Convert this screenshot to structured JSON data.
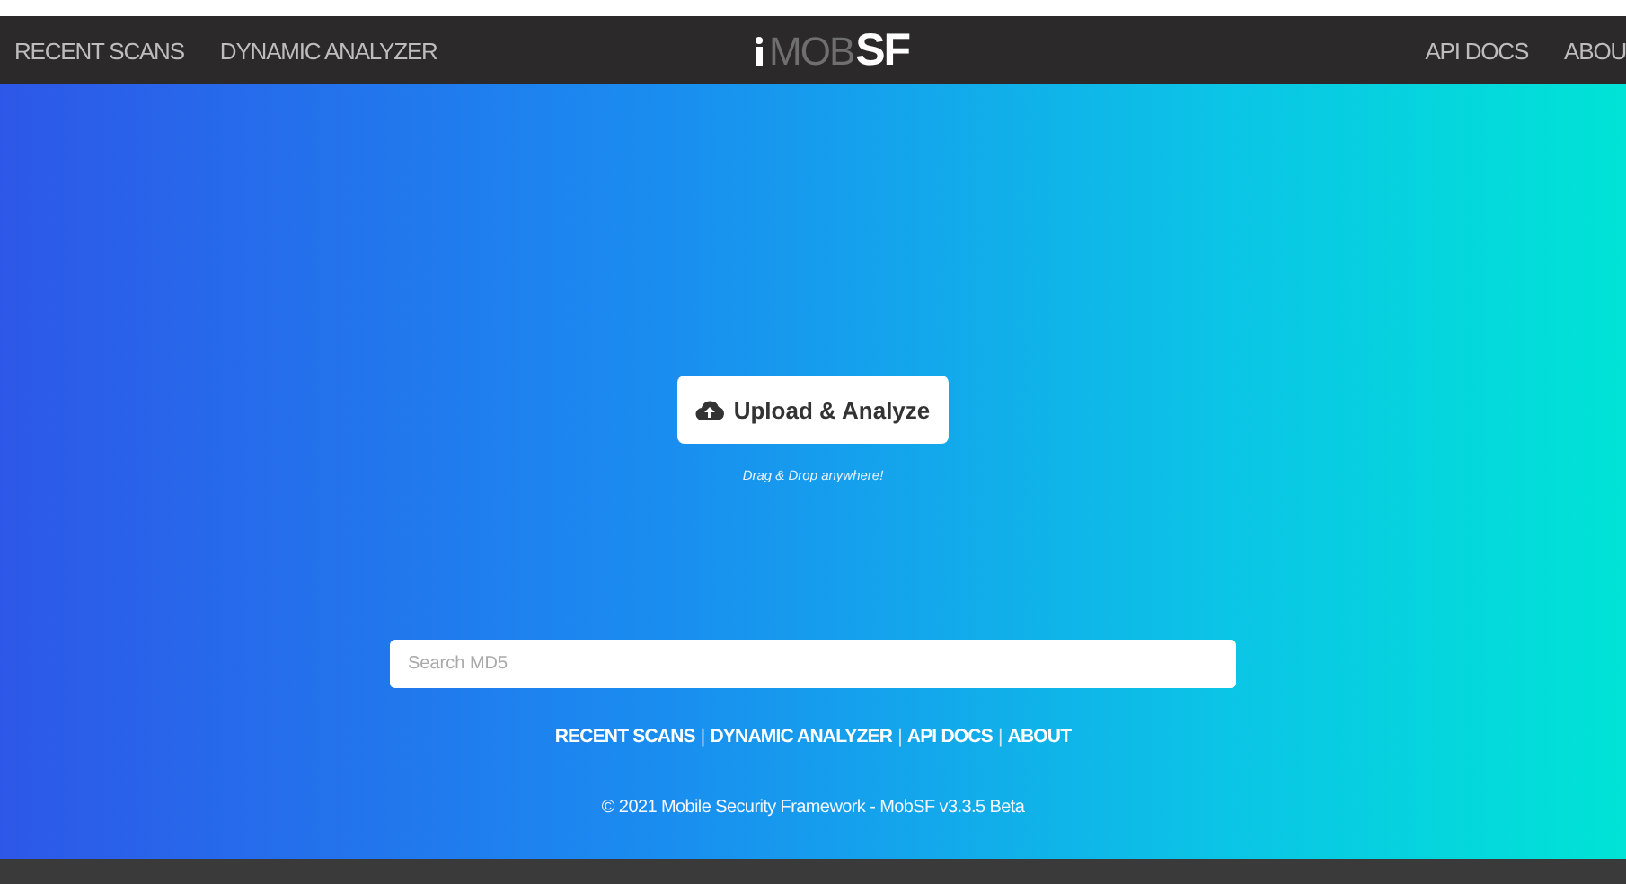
{
  "navbar": {
    "left_links": [
      "RECENT SCANS",
      "DYNAMIC ANALYZER"
    ],
    "logo": {
      "light": "MOB",
      "bold": "SF"
    },
    "right_links": [
      "API DOCS",
      "ABOU"
    ]
  },
  "upload_button": {
    "label": "Upload & Analyze"
  },
  "drag_hint": "Drag & Drop anywhere!",
  "search": {
    "placeholder": "Search MD5"
  },
  "footer_links": [
    {
      "kind": "link",
      "text": "RECENT SCANS"
    },
    {
      "kind": "separator",
      "text": "|"
    },
    {
      "kind": "link",
      "text": "DYNAMIC ANALYZER"
    },
    {
      "kind": "separator",
      "text": "|"
    },
    {
      "kind": "link",
      "text": "API DOCS"
    },
    {
      "kind": "separator",
      "text": "|"
    },
    {
      "kind": "link",
      "text": "ABOUT"
    }
  ],
  "copyright": "© 2021 Mobile Security Framework - MobSF v3.3.5 Beta"
}
